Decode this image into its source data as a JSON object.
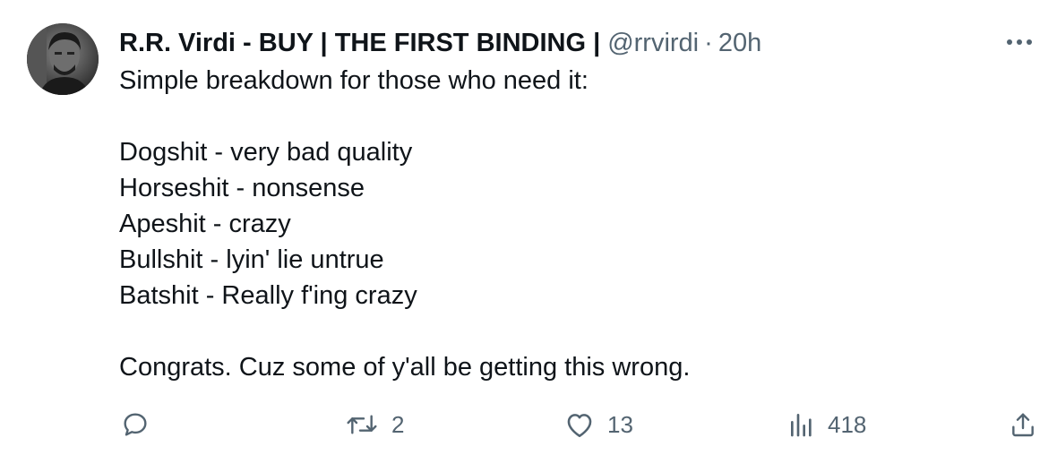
{
  "tweet": {
    "author": {
      "display_name": "R.R. Virdi - BUY | THE FIRST BINDING |",
      "handle": "@rrvirdi",
      "separator": "·",
      "timestamp": "20h"
    },
    "body_lines": [
      "Simple breakdown for those who need it:",
      "",
      "Dogshit - very bad quality",
      "Horseshit - nonsense",
      "Apeshit - crazy",
      "Bullshit - lyin' lie untrue",
      "Batshit - Really f'ing crazy",
      "",
      "Congrats. Cuz some of y'all be getting this wrong."
    ],
    "actions": {
      "reply_icon": "reply-icon",
      "retweet_icon": "retweet-icon",
      "retweet_count": "2",
      "like_icon": "heart-icon",
      "like_count": "13",
      "views_icon": "views-chart-icon",
      "views_count": "418",
      "share_icon": "share-icon"
    },
    "more_icon": "more-dots-icon",
    "colors": {
      "text": "#0f1419",
      "secondary": "#536471",
      "background": "#ffffff"
    }
  }
}
